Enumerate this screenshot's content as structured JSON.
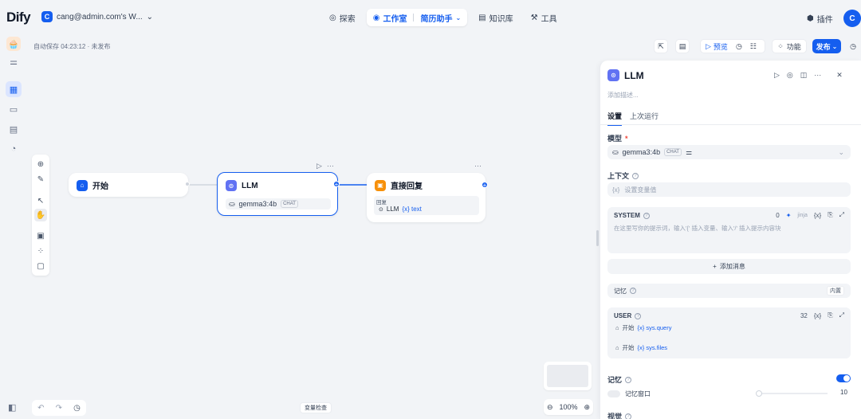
{
  "brand": "Dify",
  "workspace": {
    "avatar": "C",
    "name": "cang@admin.com's W..."
  },
  "nav": {
    "explore": "探索",
    "studio": "工作室",
    "app_name": "简历助手",
    "knowledge": "知识库",
    "tools": "工具"
  },
  "header": {
    "plugins": "插件",
    "user_avatar": "C"
  },
  "status": "自动保存 04:23:12 · 未发布",
  "actions": {
    "preview": "预览",
    "features": "功能",
    "publish": "发布"
  },
  "nodes": {
    "start": {
      "title": "开始"
    },
    "llm": {
      "title": "LLM",
      "model": "gemma3:4b",
      "model_tag": "CHAT"
    },
    "answer": {
      "title": "直接回复",
      "reply_label": "回复",
      "ref_node": "LLM",
      "ref_var": "{x} text"
    }
  },
  "canvas": {
    "zoom": "100%",
    "var_check": "变量检查"
  },
  "panel": {
    "title": "LLM",
    "desc_placeholder": "添加描述...",
    "tabs": [
      "设置",
      "上次运行"
    ],
    "model_label": "模型",
    "model": {
      "name": "gemma3:4b",
      "tag": "CHAT"
    },
    "context_label": "上下文",
    "context_placeholder": "设置变量值",
    "system": {
      "label": "SYSTEM",
      "count": "0",
      "jinja": "jinja",
      "placeholder": "在这里写你的提示词，输入'{' 插入变量、输入'/' 插入提示内容块"
    },
    "add_message": "添加消息",
    "memory_inline_label": "记忆",
    "memory_tag": "内置",
    "user": {
      "label": "USER",
      "count": "32",
      "vars": [
        {
          "node": "开始",
          "var": "{x} sys.query"
        },
        {
          "node": "开始",
          "var": "{x} sys.files"
        }
      ]
    },
    "memory_label": "记忆",
    "memory_enabled": true,
    "window_label": "记忆窗口",
    "window_value": "10",
    "vision_label": "视觉"
  },
  "colors": {
    "accent": "#155eef",
    "start_icon": "#155eef",
    "llm_icon": "#6172f3",
    "answer_icon": "#f79009"
  }
}
